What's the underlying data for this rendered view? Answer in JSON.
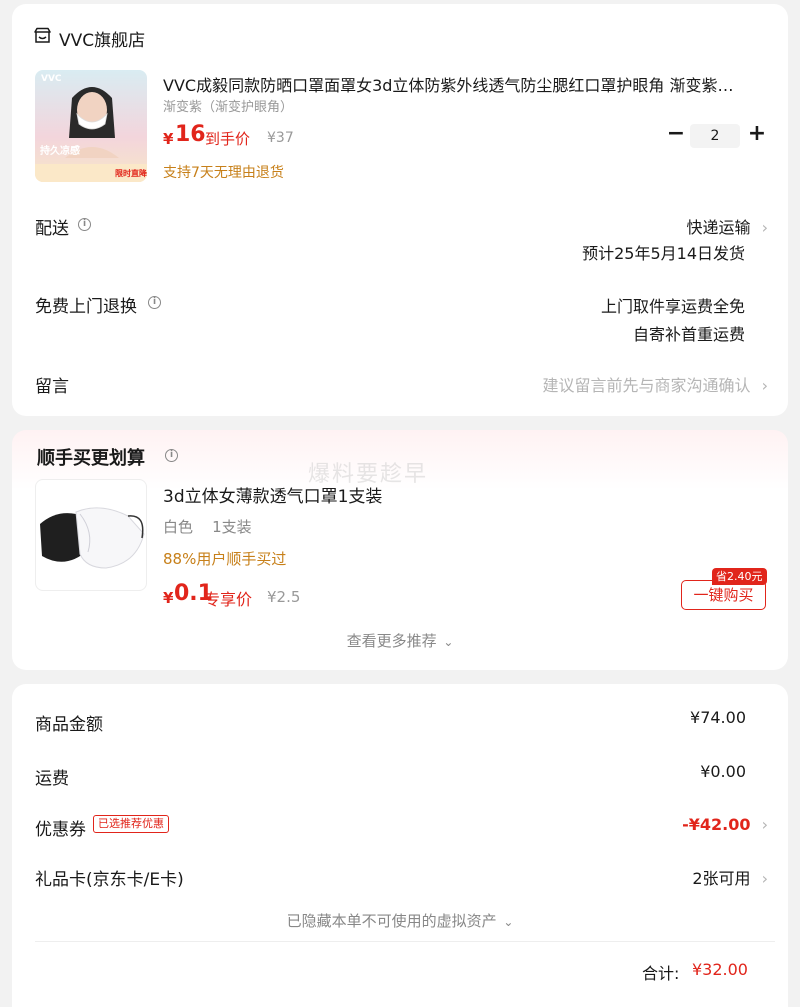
{
  "store": {
    "name": "VVC旗舰店",
    "product": {
      "title": "VVC成毅同款防晒口罩面罩女3d立体防紫外线透气防尘腮红口罩护眼角 渐变紫…",
      "spec": "渐变紫（渐变护眼角）",
      "currency": "¥",
      "price": "16",
      "price_tag": "到手价",
      "original_price": "¥37",
      "return_note": "支持7天无理由退货",
      "thumb_brand": "VVC",
      "thumb_caption": "持久凉感",
      "thumb_badge": "限时直降",
      "quantity": "2"
    },
    "delivery": {
      "label": "配送",
      "method": "快递运输",
      "eta": "预计25年5月14日发货"
    },
    "free_return": {
      "label": "免费上门退换",
      "line1": "上门取件享运费全免",
      "line2": "自寄补首重运费"
    },
    "message": {
      "label": "留言",
      "placeholder": "建议留言前先与商家沟通确认"
    }
  },
  "addon": {
    "title": "顺手买更划算",
    "watermark": "爆料要趁早",
    "name": "3d立体女薄款透气口罩1支装",
    "spec": "白色    1支装",
    "social": "88%用户顺手买过",
    "currency": "¥",
    "price": "0.1",
    "price_tag": "专享价",
    "original_price": "¥2.5",
    "save_badge": "省2.40元",
    "buy_label": "一键购买",
    "more_label": "查看更多推荐"
  },
  "summary": {
    "goods_label": "商品金额",
    "goods_value": "¥74.00",
    "shipping_label": "运费",
    "shipping_value": "¥0.00",
    "coupon_label": "优惠券",
    "coupon_badge": "已选推荐优惠",
    "coupon_value": "-¥42.00",
    "giftcard_label": "礼品卡(京东卡/E卡)",
    "giftcard_value": "2张可用",
    "hidden_assets": "已隐藏本单不可使用的虚拟资产",
    "total_label": "合计:",
    "total_value": "¥32.00"
  },
  "colors": {
    "accent": "#e1251b",
    "note": "#c7801a",
    "muted": "#999999"
  }
}
